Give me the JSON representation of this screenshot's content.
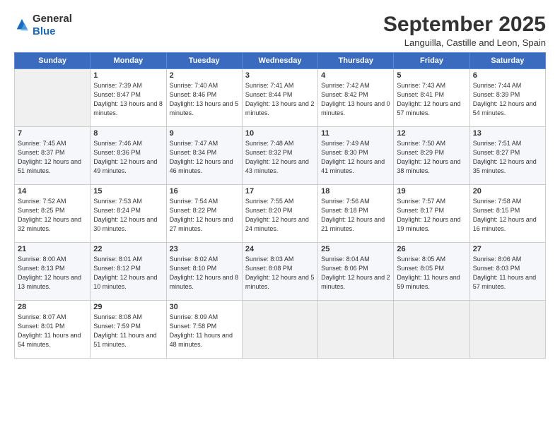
{
  "logo": {
    "general": "General",
    "blue": "Blue"
  },
  "title": "September 2025",
  "location": "Languilla, Castille and Leon, Spain",
  "weekdays": [
    "Sunday",
    "Monday",
    "Tuesday",
    "Wednesday",
    "Thursday",
    "Friday",
    "Saturday"
  ],
  "weeks": [
    [
      {
        "day": "",
        "sunrise": "",
        "sunset": "",
        "daylight": ""
      },
      {
        "day": "1",
        "sunrise": "Sunrise: 7:39 AM",
        "sunset": "Sunset: 8:47 PM",
        "daylight": "Daylight: 13 hours and 8 minutes."
      },
      {
        "day": "2",
        "sunrise": "Sunrise: 7:40 AM",
        "sunset": "Sunset: 8:46 PM",
        "daylight": "Daylight: 13 hours and 5 minutes."
      },
      {
        "day": "3",
        "sunrise": "Sunrise: 7:41 AM",
        "sunset": "Sunset: 8:44 PM",
        "daylight": "Daylight: 13 hours and 2 minutes."
      },
      {
        "day": "4",
        "sunrise": "Sunrise: 7:42 AM",
        "sunset": "Sunset: 8:42 PM",
        "daylight": "Daylight: 13 hours and 0 minutes."
      },
      {
        "day": "5",
        "sunrise": "Sunrise: 7:43 AM",
        "sunset": "Sunset: 8:41 PM",
        "daylight": "Daylight: 12 hours and 57 minutes."
      },
      {
        "day": "6",
        "sunrise": "Sunrise: 7:44 AM",
        "sunset": "Sunset: 8:39 PM",
        "daylight": "Daylight: 12 hours and 54 minutes."
      }
    ],
    [
      {
        "day": "7",
        "sunrise": "Sunrise: 7:45 AM",
        "sunset": "Sunset: 8:37 PM",
        "daylight": "Daylight: 12 hours and 51 minutes."
      },
      {
        "day": "8",
        "sunrise": "Sunrise: 7:46 AM",
        "sunset": "Sunset: 8:36 PM",
        "daylight": "Daylight: 12 hours and 49 minutes."
      },
      {
        "day": "9",
        "sunrise": "Sunrise: 7:47 AM",
        "sunset": "Sunset: 8:34 PM",
        "daylight": "Daylight: 12 hours and 46 minutes."
      },
      {
        "day": "10",
        "sunrise": "Sunrise: 7:48 AM",
        "sunset": "Sunset: 8:32 PM",
        "daylight": "Daylight: 12 hours and 43 minutes."
      },
      {
        "day": "11",
        "sunrise": "Sunrise: 7:49 AM",
        "sunset": "Sunset: 8:30 PM",
        "daylight": "Daylight: 12 hours and 41 minutes."
      },
      {
        "day": "12",
        "sunrise": "Sunrise: 7:50 AM",
        "sunset": "Sunset: 8:29 PM",
        "daylight": "Daylight: 12 hours and 38 minutes."
      },
      {
        "day": "13",
        "sunrise": "Sunrise: 7:51 AM",
        "sunset": "Sunset: 8:27 PM",
        "daylight": "Daylight: 12 hours and 35 minutes."
      }
    ],
    [
      {
        "day": "14",
        "sunrise": "Sunrise: 7:52 AM",
        "sunset": "Sunset: 8:25 PM",
        "daylight": "Daylight: 12 hours and 32 minutes."
      },
      {
        "day": "15",
        "sunrise": "Sunrise: 7:53 AM",
        "sunset": "Sunset: 8:24 PM",
        "daylight": "Daylight: 12 hours and 30 minutes."
      },
      {
        "day": "16",
        "sunrise": "Sunrise: 7:54 AM",
        "sunset": "Sunset: 8:22 PM",
        "daylight": "Daylight: 12 hours and 27 minutes."
      },
      {
        "day": "17",
        "sunrise": "Sunrise: 7:55 AM",
        "sunset": "Sunset: 8:20 PM",
        "daylight": "Daylight: 12 hours and 24 minutes."
      },
      {
        "day": "18",
        "sunrise": "Sunrise: 7:56 AM",
        "sunset": "Sunset: 8:18 PM",
        "daylight": "Daylight: 12 hours and 21 minutes."
      },
      {
        "day": "19",
        "sunrise": "Sunrise: 7:57 AM",
        "sunset": "Sunset: 8:17 PM",
        "daylight": "Daylight: 12 hours and 19 minutes."
      },
      {
        "day": "20",
        "sunrise": "Sunrise: 7:58 AM",
        "sunset": "Sunset: 8:15 PM",
        "daylight": "Daylight: 12 hours and 16 minutes."
      }
    ],
    [
      {
        "day": "21",
        "sunrise": "Sunrise: 8:00 AM",
        "sunset": "Sunset: 8:13 PM",
        "daylight": "Daylight: 12 hours and 13 minutes."
      },
      {
        "day": "22",
        "sunrise": "Sunrise: 8:01 AM",
        "sunset": "Sunset: 8:12 PM",
        "daylight": "Daylight: 12 hours and 10 minutes."
      },
      {
        "day": "23",
        "sunrise": "Sunrise: 8:02 AM",
        "sunset": "Sunset: 8:10 PM",
        "daylight": "Daylight: 12 hours and 8 minutes."
      },
      {
        "day": "24",
        "sunrise": "Sunrise: 8:03 AM",
        "sunset": "Sunset: 8:08 PM",
        "daylight": "Daylight: 12 hours and 5 minutes."
      },
      {
        "day": "25",
        "sunrise": "Sunrise: 8:04 AM",
        "sunset": "Sunset: 8:06 PM",
        "daylight": "Daylight: 12 hours and 2 minutes."
      },
      {
        "day": "26",
        "sunrise": "Sunrise: 8:05 AM",
        "sunset": "Sunset: 8:05 PM",
        "daylight": "Daylight: 11 hours and 59 minutes."
      },
      {
        "day": "27",
        "sunrise": "Sunrise: 8:06 AM",
        "sunset": "Sunset: 8:03 PM",
        "daylight": "Daylight: 11 hours and 57 minutes."
      }
    ],
    [
      {
        "day": "28",
        "sunrise": "Sunrise: 8:07 AM",
        "sunset": "Sunset: 8:01 PM",
        "daylight": "Daylight: 11 hours and 54 minutes."
      },
      {
        "day": "29",
        "sunrise": "Sunrise: 8:08 AM",
        "sunset": "Sunset: 7:59 PM",
        "daylight": "Daylight: 11 hours and 51 minutes."
      },
      {
        "day": "30",
        "sunrise": "Sunrise: 8:09 AM",
        "sunset": "Sunset: 7:58 PM",
        "daylight": "Daylight: 11 hours and 48 minutes."
      },
      {
        "day": "",
        "sunrise": "",
        "sunset": "",
        "daylight": ""
      },
      {
        "day": "",
        "sunrise": "",
        "sunset": "",
        "daylight": ""
      },
      {
        "day": "",
        "sunrise": "",
        "sunset": "",
        "daylight": ""
      },
      {
        "day": "",
        "sunrise": "",
        "sunset": "",
        "daylight": ""
      }
    ]
  ]
}
